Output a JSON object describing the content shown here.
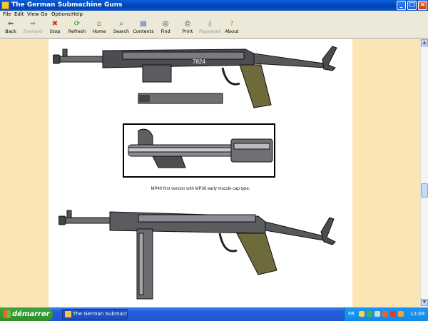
{
  "window": {
    "title": "The German Submachine Guns"
  },
  "menu": [
    "File",
    "Edit",
    "View",
    "Go",
    "Options",
    "Help"
  ],
  "toolbar": [
    {
      "label": "Back",
      "icon": "back-arrow-icon",
      "glyph": "⬅",
      "enabled": true,
      "color": "#2a9a2a"
    },
    {
      "label": "Forward",
      "icon": "forward-arrow-icon",
      "glyph": "➡",
      "enabled": false,
      "color": "#a0a0a0"
    },
    {
      "label": "Stop",
      "icon": "stop-icon",
      "glyph": "✖",
      "enabled": true,
      "color": "#d42c1a"
    },
    {
      "label": "Refresh",
      "icon": "refresh-icon",
      "glyph": "⟳",
      "enabled": true,
      "color": "#2a9a2a"
    },
    {
      "label": "Home",
      "icon": "home-icon",
      "glyph": "⌂",
      "enabled": true,
      "color": "#a6691c"
    },
    {
      "label": "Search",
      "icon": "search-icon",
      "glyph": "⌕",
      "enabled": true,
      "color": "#2255aa"
    },
    {
      "label": "Contents",
      "icon": "contents-icon",
      "glyph": "▤",
      "enabled": true,
      "color": "#2255aa"
    },
    {
      "label": "Find",
      "icon": "binoculars-icon",
      "glyph": "◎",
      "enabled": true,
      "color": "#333333"
    },
    {
      "label": "Print",
      "icon": "printer-icon",
      "glyph": "⎙",
      "enabled": true,
      "color": "#444444"
    },
    {
      "label": "Password",
      "icon": "key-icon",
      "glyph": "⚷",
      "enabled": false,
      "color": "#a0a0a0"
    },
    {
      "label": "About",
      "icon": "about-icon",
      "glyph": "?",
      "enabled": true,
      "color": "#c08a00"
    }
  ],
  "content": {
    "caption": "MP40 first version with MP38 early muzzle cap type.",
    "gun_serial": "7824"
  },
  "taskbar": {
    "start_label": "démarrer",
    "task_label": "The German Submachi...",
    "language": "FR",
    "clock": "12:09"
  },
  "colors": {
    "page_background": "#fbe5b5",
    "titlebar": "#0142b5",
    "taskbar": "#245edb",
    "start": "#2e8f2b"
  }
}
